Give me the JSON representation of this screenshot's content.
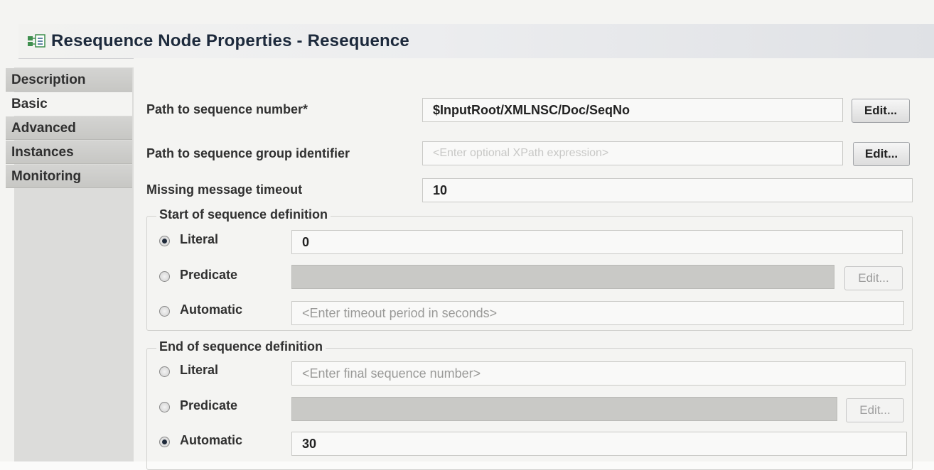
{
  "window": {
    "title": "Resequence Node Properties - Resequence",
    "icon": "properties-node-icon"
  },
  "tabs": [
    {
      "label": "Description",
      "active": false
    },
    {
      "label": "Basic",
      "active": true
    },
    {
      "label": "Advanced",
      "active": false
    },
    {
      "label": "Instances",
      "active": false
    },
    {
      "label": "Monitoring",
      "active": false
    }
  ],
  "basic": {
    "seq_number": {
      "label": "Path to sequence number*",
      "value": "$InputRoot/XMLNSC/Doc/SeqNo",
      "edit_label": "Edit..."
    },
    "seq_group": {
      "label": "Path to sequence group identifier",
      "placeholder": "<Enter optional XPath expression>",
      "edit_label": "Edit..."
    },
    "timeout": {
      "label": "Missing message timeout",
      "value": "10"
    }
  },
  "start_def": {
    "title": "Start of sequence definition",
    "literal_label": "Literal",
    "literal_value": "0",
    "predicate_label": "Predicate",
    "predicate_edit": "Edit...",
    "automatic_label": "Automatic",
    "automatic_placeholder": "<Enter timeout period in seconds>",
    "selected": "Literal"
  },
  "end_def": {
    "title": "End of sequence definition",
    "literal_label": "Literal",
    "literal_placeholder": "<Enter final sequence number>",
    "predicate_label": "Predicate",
    "predicate_edit": "Edit...",
    "automatic_label": "Automatic",
    "automatic_value": "30",
    "selected": "Automatic"
  },
  "colors": {
    "title_text": "#1d2a3c",
    "sidebar_bg": "#dcdcda",
    "content_bg": "#f4f4f2"
  }
}
